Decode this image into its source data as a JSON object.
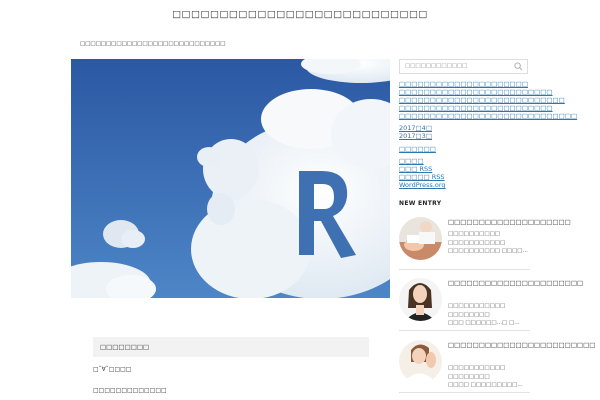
{
  "site": {
    "title": "□□□□□□□□□□□□□□□□□□□□□□□□□□□",
    "tagline": "□□□□□□□□□□□□□□□□□□□□□□□□□□□□"
  },
  "content": {
    "box_heading": "□□□□□□□□",
    "para1": "□ˇ∀ˇ□□□□",
    "para2": "□□□□□□□□□□□□□"
  },
  "sidebar": {
    "search_placeholder": "□□□□□□□□□□□□",
    "links_group1": [
      "□□□□□□□□□□□□□□□□□□□□□",
      "□□□□□□□□□□□□□□□□□□□□□□□□□",
      "□□□□□□□□□□□□□□□□□□□□□□□□□□□",
      "□□□□□□□□□□□□□□□□□□□□□□□□□",
      "□□□□□□□□□□□□□□□□□□□□□□□□□□□□□"
    ],
    "archives": [
      "2017□4□",
      "2017□3□"
    ],
    "category": "□□□□□□",
    "meta": [
      "□□□□",
      "□□□ RSS",
      "□□□□□ RSS",
      "WordPress.org"
    ],
    "new_entry_heading": "NEW ENTRY",
    "entries": [
      {
        "title": "□□□□□□□□□□□□□□□□□□□□",
        "excerpt": [
          "□□□□□□□□□□ □□□□□□□□□□□",
          "□□□□□□□□□□ □□□□…"
        ]
      },
      {
        "title": "□□□□□□□□□□□□□□□□□□□□□□",
        "excerpt": [
          "□□□□□□□□□□□ □□□□□□□□",
          "□□□ □□□□□□…□ □…"
        ]
      },
      {
        "title": "□□□□□□□□□□□□□□□□□□□□□□□□",
        "excerpt": [
          "□□□□□□□□□□□ □□□□□□□□",
          "□□□□ □□□□□□□□□…"
        ]
      }
    ]
  },
  "colors": {
    "link": "#2a77b2",
    "sky": "#2f5fa8",
    "box_bg": "#f2f2f2"
  }
}
